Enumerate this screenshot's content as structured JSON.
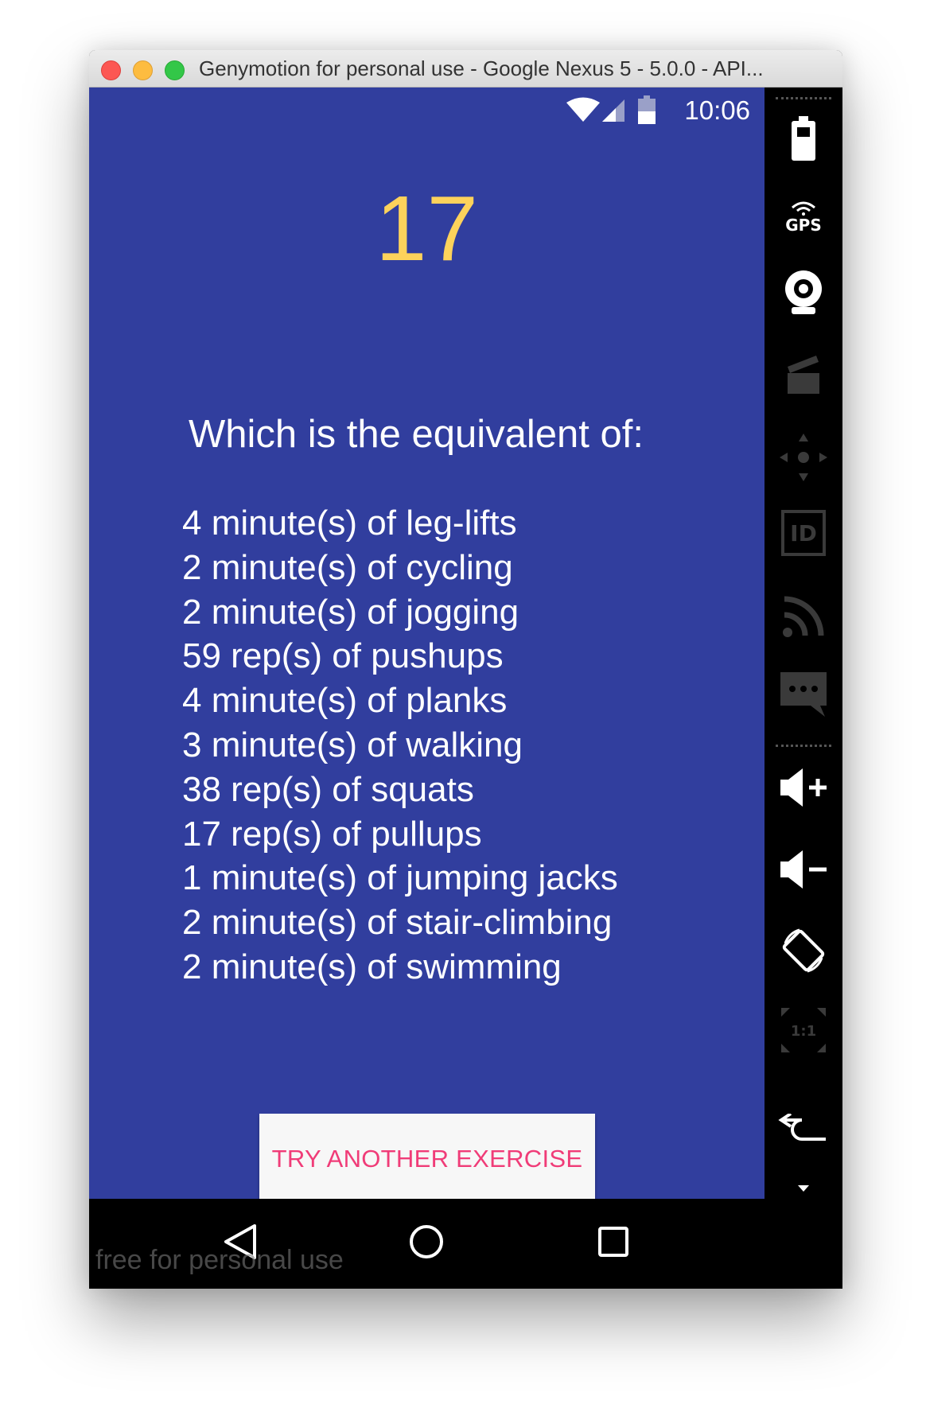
{
  "window": {
    "title": "Genymotion for personal use - Google Nexus 5 - 5.0.0 - API..."
  },
  "statusbar": {
    "time": "10:06"
  },
  "main": {
    "counter": "17",
    "heading": "Which is the equivalent of:",
    "equivalents": [
      "4 minute(s) of leg-lifts",
      "2 minute(s) of cycling",
      "2 minute(s) of jogging",
      "59 rep(s) of pushups",
      "4 minute(s) of planks",
      "3 minute(s) of walking",
      "38 rep(s) of squats",
      "17 rep(s) of pullups",
      "1 minute(s) of jumping jacks",
      "2 minute(s) of stair-climbing",
      "2 minute(s) of swimming"
    ],
    "button_label": "TRY ANOTHER EXERCISE"
  },
  "side_panel": {
    "gps_label": "GPS",
    "id_label": "ID",
    "ratio_label": "1:1"
  },
  "watermark": "free for personal use",
  "colors": {
    "background": "#313e9e",
    "counter": "#fdd25b",
    "button_text": "#f03c78",
    "button_bg": "#f7f7f7"
  }
}
